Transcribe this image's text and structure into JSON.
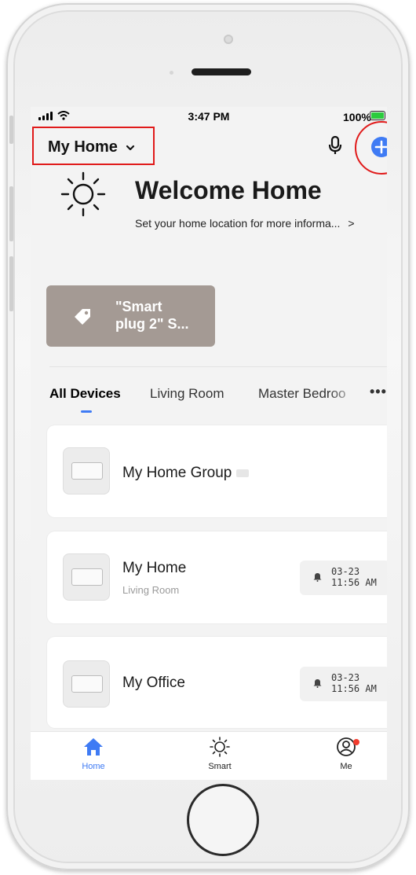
{
  "status_bar": {
    "time": "3:47 PM",
    "battery_percent": "100%"
  },
  "header": {
    "home_selector": "My Home",
    "add_button_icon": "plus-icon",
    "mic_icon": "microphone-icon"
  },
  "welcome": {
    "title": "Welcome Home",
    "subtitle": "Set your home location for more informa...",
    "chevron": ">"
  },
  "scene": {
    "label_line1": "\"Smart",
    "label_line2": "plug 2\" S..."
  },
  "tabs": {
    "items": [
      "All Devices",
      "Living Room",
      "Master Bedroo"
    ],
    "more": "•••",
    "active": "All Devices"
  },
  "devices": [
    {
      "name": "My Home Group",
      "room": "",
      "stamp_date": "",
      "stamp_time": ""
    },
    {
      "name": "My Home",
      "room": "Living Room",
      "stamp_date": "03-23",
      "stamp_time": "11:56 AM"
    },
    {
      "name": "My Office",
      "room": "",
      "stamp_date": "03-23",
      "stamp_time": "11:56 AM"
    }
  ],
  "bottom_nav": {
    "items": [
      "Home",
      "Smart",
      "Me"
    ],
    "active": "Home"
  },
  "colors": {
    "accent": "#3f7bf4",
    "highlight": "#e01a1a",
    "scene_card": "#a49a94"
  }
}
